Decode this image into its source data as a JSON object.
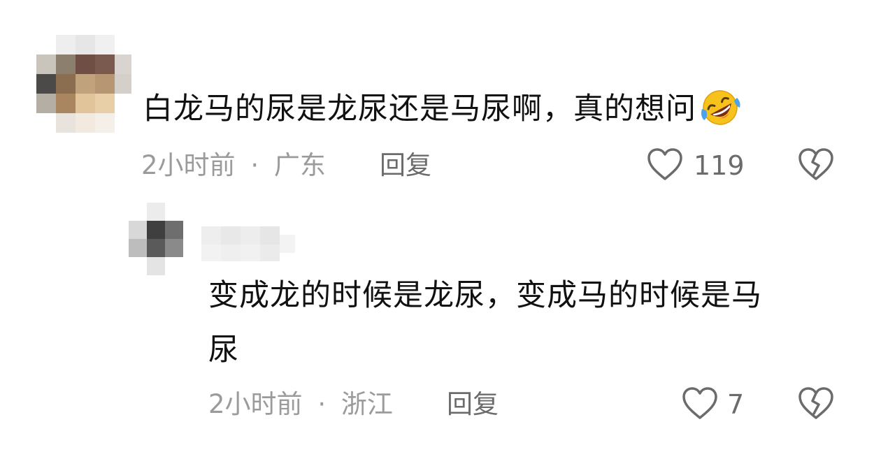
{
  "comments": [
    {
      "text": "白龙马的尿是龙尿还是马尿啊，真的想问",
      "emoji": "rolling-on-floor-laughing-emoji",
      "time": "2小时前",
      "separator": "·",
      "location": "广东",
      "reply_label": "回复",
      "likes": "119"
    },
    {
      "text_line1": "变成龙的时候是龙尿，变成马的时候是马",
      "text_line2": "尿",
      "time": "2小时前",
      "separator": "·",
      "location": "浙江",
      "reply_label": "回复",
      "likes": "7"
    }
  ],
  "colors": {
    "text": "#111111",
    "meta": "#9b9b9b",
    "action": "#6b6b6b",
    "background": "#ffffff"
  }
}
